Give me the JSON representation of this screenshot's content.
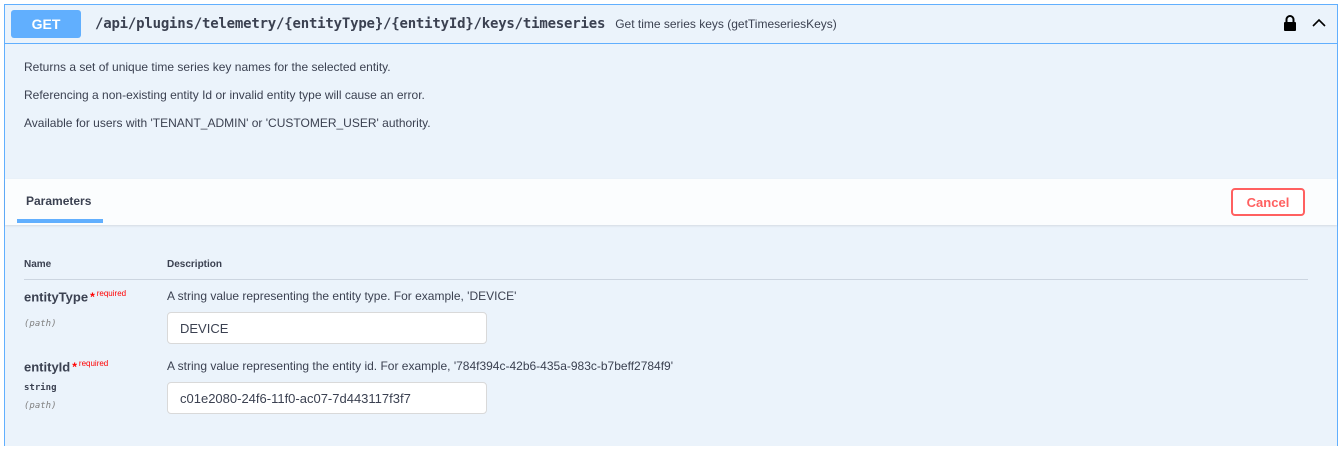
{
  "summary": {
    "method": "GET",
    "path": "/api/plugins/telemetry/{entityType}/{entityId}/keys/timeseries",
    "description": "Get time series keys (getTimeseriesKeys)"
  },
  "description": {
    "lines": [
      "Returns a set of unique time series key names for the selected entity.",
      "Referencing a non-existing entity Id or invalid entity type will cause an error.",
      "Available for users with 'TENANT_ADMIN' or 'CUSTOMER_USER' authority."
    ]
  },
  "parameters_section": {
    "tab_label": "Parameters",
    "cancel_label": "Cancel",
    "col_name": "Name",
    "col_description": "Description"
  },
  "parameters": [
    {
      "name": "entityType",
      "required_star": "*",
      "required_label": "required",
      "type": "",
      "in": "(path)",
      "description": "A string value representing the entity type. For example, 'DEVICE'",
      "value": "DEVICE"
    },
    {
      "name": "entityId",
      "required_star": "*",
      "required_label": "required",
      "type": "string",
      "in": "(path)",
      "description": "A string value representing the entity id. For example, '784f394c-42b6-435a-983c-b7beff2784f9'",
      "value": "c01e2080-24f6-11f0-ac07-7d443117f3f7"
    }
  ],
  "colors": {
    "get_accent": "#61affe",
    "block_bg": "#ebf3fb",
    "cancel_red": "#ff6060",
    "required_red": "#ff0000"
  },
  "icons": {
    "lock": "lock-icon",
    "collapse": "chevron-up-icon"
  }
}
